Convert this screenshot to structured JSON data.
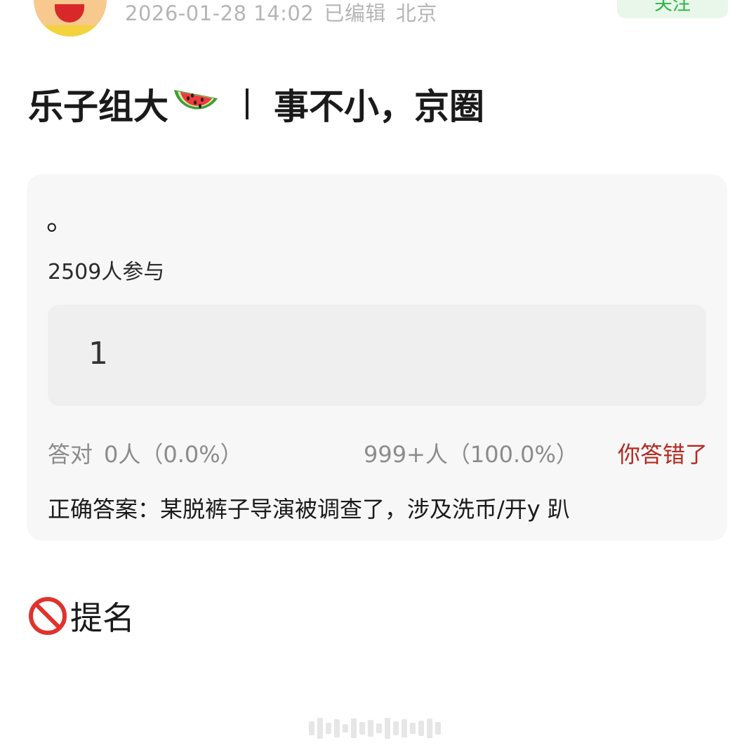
{
  "header": {
    "timestamp": "2026-01-28 14:02",
    "edited_label": "已编辑",
    "location": "北京",
    "follow_label": "关注"
  },
  "post": {
    "title_part1": "乐子组大",
    "title_emoji": "watermelon-icon",
    "title_part2": "事不小，京圈"
  },
  "quiz": {
    "question": "。",
    "participants": "2509人参与",
    "option": "1",
    "correct_label": "答对",
    "correct_stat": "0人（0.0%）",
    "option_stat": "999+人（100.0%）",
    "verdict": "你答错了",
    "answer": "正确答案：某脱裤子导演被调查了，涉及洗币/开y 趴"
  },
  "section": {
    "icon": "no-entry-icon",
    "heading": "提名"
  },
  "colors": {
    "card_bg": "#f7f7f7",
    "option_bg": "#efefef",
    "muted_text": "#8c8c8c",
    "meta_text": "#b5b5b5",
    "verdict_red": "#b52a22",
    "follow_green": "#2db34a",
    "follow_bg": "#e8f7e9"
  }
}
